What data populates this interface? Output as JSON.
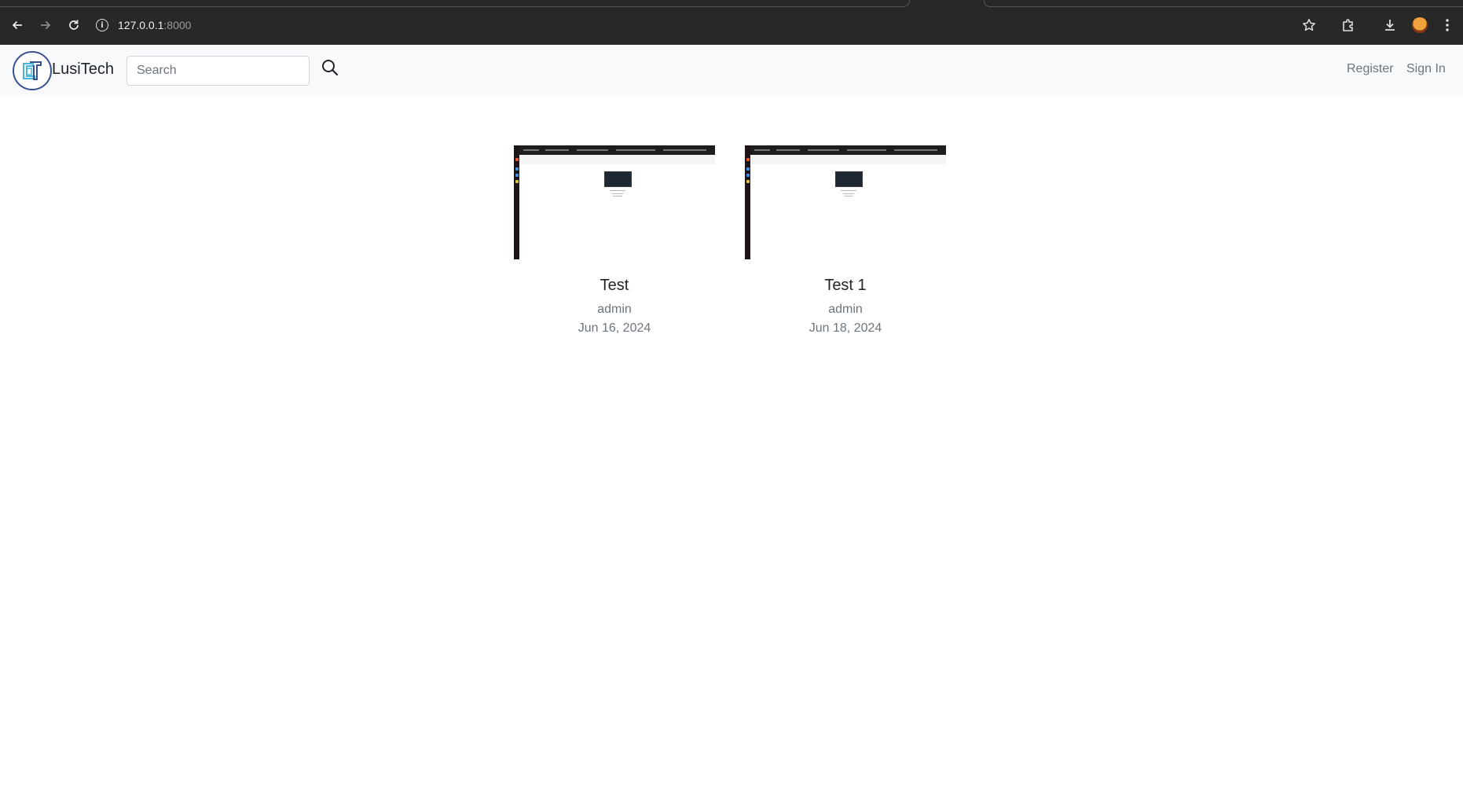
{
  "browser": {
    "url_host": "127.0.0.1",
    "url_port": ":8000",
    "icons": [
      "back-arrow-icon",
      "forward-arrow-icon",
      "reload-icon",
      "site-info-icon",
      "bookmark-star-icon",
      "extensions-icon",
      "download-icon",
      "profile-avatar",
      "menu-dots-icon"
    ]
  },
  "navbar": {
    "brand": "LusiTech",
    "search_placeholder": "Search",
    "register_label": "Register",
    "signin_label": "Sign In"
  },
  "posts": [
    {
      "title": "Test",
      "author": "admin",
      "date": "Jun 16, 2024"
    },
    {
      "title": "Test 1",
      "author": "admin",
      "date": "Jun 18, 2024"
    }
  ],
  "colors": {
    "browser_bg": "#282828",
    "navbar_bg": "#f8f9fa",
    "muted_text": "#6c757d",
    "logo_ring": "#3a5190"
  }
}
